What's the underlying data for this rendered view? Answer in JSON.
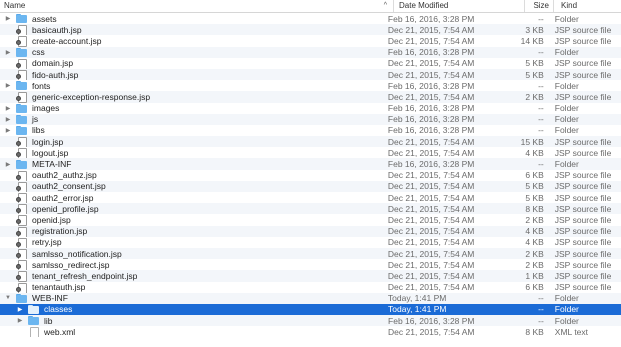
{
  "header": {
    "name": "Name",
    "date_modified": "Date Modified",
    "size": "Size",
    "kind": "Kind",
    "sort_indicator": "^"
  },
  "colors": {
    "selection": "#1b6bd6",
    "folder": "#6cb6f0",
    "stripe": "#f3f6fa"
  },
  "rows": [
    {
      "name": "assets",
      "date": "Feb 16, 2016, 3:28 PM",
      "size": "--",
      "kind": "Folder",
      "type": "folder",
      "indent": 0,
      "disclosure": "right"
    },
    {
      "name": "basicauth.jsp",
      "date": "Dec 21, 2015, 7:54 AM",
      "size": "3 KB",
      "kind": "JSP source file",
      "type": "jsp",
      "indent": 0,
      "disclosure": ""
    },
    {
      "name": "create-account.jsp",
      "date": "Dec 21, 2015, 7:54 AM",
      "size": "14 KB",
      "kind": "JSP source file",
      "type": "jsp",
      "indent": 0,
      "disclosure": ""
    },
    {
      "name": "css",
      "date": "Feb 16, 2016, 3:28 PM",
      "size": "--",
      "kind": "Folder",
      "type": "folder",
      "indent": 0,
      "disclosure": "right"
    },
    {
      "name": "domain.jsp",
      "date": "Dec 21, 2015, 7:54 AM",
      "size": "5 KB",
      "kind": "JSP source file",
      "type": "jsp",
      "indent": 0,
      "disclosure": ""
    },
    {
      "name": "fido-auth.jsp",
      "date": "Dec 21, 2015, 7:54 AM",
      "size": "5 KB",
      "kind": "JSP source file",
      "type": "jsp",
      "indent": 0,
      "disclosure": ""
    },
    {
      "name": "fonts",
      "date": "Feb 16, 2016, 3:28 PM",
      "size": "--",
      "kind": "Folder",
      "type": "folder",
      "indent": 0,
      "disclosure": "right"
    },
    {
      "name": "generic-exception-response.jsp",
      "date": "Dec 21, 2015, 7:54 AM",
      "size": "2 KB",
      "kind": "JSP source file",
      "type": "jsp",
      "indent": 0,
      "disclosure": ""
    },
    {
      "name": "images",
      "date": "Feb 16, 2016, 3:28 PM",
      "size": "--",
      "kind": "Folder",
      "type": "folder",
      "indent": 0,
      "disclosure": "right"
    },
    {
      "name": "js",
      "date": "Feb 16, 2016, 3:28 PM",
      "size": "--",
      "kind": "Folder",
      "type": "folder",
      "indent": 0,
      "disclosure": "right"
    },
    {
      "name": "libs",
      "date": "Feb 16, 2016, 3:28 PM",
      "size": "--",
      "kind": "Folder",
      "type": "folder",
      "indent": 0,
      "disclosure": "right"
    },
    {
      "name": "login.jsp",
      "date": "Dec 21, 2015, 7:54 AM",
      "size": "15 KB",
      "kind": "JSP source file",
      "type": "jsp",
      "indent": 0,
      "disclosure": ""
    },
    {
      "name": "logout.jsp",
      "date": "Dec 21, 2015, 7:54 AM",
      "size": "4 KB",
      "kind": "JSP source file",
      "type": "jsp",
      "indent": 0,
      "disclosure": ""
    },
    {
      "name": "META-INF",
      "date": "Feb 16, 2016, 3:28 PM",
      "size": "--",
      "kind": "Folder",
      "type": "folder",
      "indent": 0,
      "disclosure": "right"
    },
    {
      "name": "oauth2_authz.jsp",
      "date": "Dec 21, 2015, 7:54 AM",
      "size": "6 KB",
      "kind": "JSP source file",
      "type": "jsp",
      "indent": 0,
      "disclosure": ""
    },
    {
      "name": "oauth2_consent.jsp",
      "date": "Dec 21, 2015, 7:54 AM",
      "size": "5 KB",
      "kind": "JSP source file",
      "type": "jsp",
      "indent": 0,
      "disclosure": ""
    },
    {
      "name": "oauth2_error.jsp",
      "date": "Dec 21, 2015, 7:54 AM",
      "size": "5 KB",
      "kind": "JSP source file",
      "type": "jsp",
      "indent": 0,
      "disclosure": ""
    },
    {
      "name": "openid_profile.jsp",
      "date": "Dec 21, 2015, 7:54 AM",
      "size": "8 KB",
      "kind": "JSP source file",
      "type": "jsp",
      "indent": 0,
      "disclosure": ""
    },
    {
      "name": "openid.jsp",
      "date": "Dec 21, 2015, 7:54 AM",
      "size": "2 KB",
      "kind": "JSP source file",
      "type": "jsp",
      "indent": 0,
      "disclosure": ""
    },
    {
      "name": "registration.jsp",
      "date": "Dec 21, 2015, 7:54 AM",
      "size": "4 KB",
      "kind": "JSP source file",
      "type": "jsp",
      "indent": 0,
      "disclosure": ""
    },
    {
      "name": "retry.jsp",
      "date": "Dec 21, 2015, 7:54 AM",
      "size": "4 KB",
      "kind": "JSP source file",
      "type": "jsp",
      "indent": 0,
      "disclosure": ""
    },
    {
      "name": "samlsso_notification.jsp",
      "date": "Dec 21, 2015, 7:54 AM",
      "size": "2 KB",
      "kind": "JSP source file",
      "type": "jsp",
      "indent": 0,
      "disclosure": ""
    },
    {
      "name": "samlsso_redirect.jsp",
      "date": "Dec 21, 2015, 7:54 AM",
      "size": "2 KB",
      "kind": "JSP source file",
      "type": "jsp",
      "indent": 0,
      "disclosure": ""
    },
    {
      "name": "tenant_refresh_endpoint.jsp",
      "date": "Dec 21, 2015, 7:54 AM",
      "size": "1 KB",
      "kind": "JSP source file",
      "type": "jsp",
      "indent": 0,
      "disclosure": ""
    },
    {
      "name": "tenantauth.jsp",
      "date": "Dec 21, 2015, 7:54 AM",
      "size": "6 KB",
      "kind": "JSP source file",
      "type": "jsp",
      "indent": 0,
      "disclosure": ""
    },
    {
      "name": "WEB-INF",
      "date": "Today, 1:41 PM",
      "size": "--",
      "kind": "Folder",
      "type": "folder",
      "indent": 0,
      "disclosure": "down"
    },
    {
      "name": "classes",
      "date": "Today, 1:41 PM",
      "size": "--",
      "kind": "Folder",
      "type": "folder",
      "indent": 1,
      "disclosure": "right",
      "selected": true
    },
    {
      "name": "lib",
      "date": "Feb 16, 2016, 3:28 PM",
      "size": "--",
      "kind": "Folder",
      "type": "folder",
      "indent": 1,
      "disclosure": "right"
    },
    {
      "name": "web.xml",
      "date": "Dec 21, 2015, 7:54 AM",
      "size": "8 KB",
      "kind": "XML text",
      "type": "xml",
      "indent": 1,
      "disclosure": ""
    }
  ]
}
